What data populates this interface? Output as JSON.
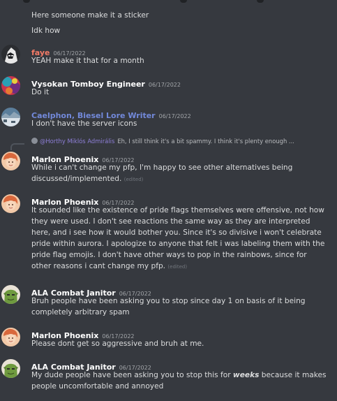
{
  "messages": [
    {
      "continuation": true,
      "lines": [
        "Here someone make it a sticker"
      ]
    },
    {
      "continuation": true,
      "lines": [
        "Idk how"
      ]
    },
    {
      "author": "faye",
      "author_color": "#f47b67",
      "timestamp": "06/17/2022",
      "avatar_icon": "anime-character-avatar",
      "lines": [
        "YEAH make it that for a month"
      ]
    },
    {
      "author": "Vysokan Tomboy Engineer",
      "author_color": "#ffffff",
      "timestamp": "06/17/2022",
      "avatar_icon": "colorful-abstract-avatar",
      "lines": [
        "Do it"
      ]
    },
    {
      "author": "Caelphon, Biesel Lore Writer",
      "author_color": "#7289da",
      "timestamp": "06/17/2022",
      "avatar_icon": "landscape-avatar",
      "lines": [
        "I don't have the server icons"
      ]
    },
    {
      "reply": {
        "author": "@Horthy Miklós Admirális",
        "text": "Eh, I still think it's a bit spammy. I think it's plenty enough ..."
      },
      "author": "Marlon Phoenix",
      "author_color": "#ffffff",
      "timestamp": "06/17/2022",
      "avatar_icon": "marlon-phoenix-avatar",
      "lines": [
        "While i can't change my pfp, I'm happy to see other alternatives being",
        "discussed/implemented."
      ],
      "edited": "(edited)"
    },
    {
      "author": "Marlon Phoenix",
      "author_color": "#ffffff",
      "timestamp": "06/17/2022",
      "avatar_icon": "marlon-phoenix-avatar",
      "lines": [
        "It sounded like the existence of pride flags themselves were offensive, not how",
        "they were used. I don't see reactions the same way as they are interpreted",
        "here, and i see how it would bother you. Since it's so divisive i won't celebrate",
        "pride within aurora. I apologize to anyone that felt i was labeling them with the",
        "pride flag emojis. I don't have other ways to pop in the rainbows, since for",
        "other reasons i cant change my pfp."
      ],
      "edited": "(edited)"
    },
    {
      "author": "ALA Combat Janitor",
      "author_color": "#ffffff",
      "timestamp": "06/17/2022",
      "avatar_icon": "green-goblin-avatar",
      "lines": [
        "Bruh people have been asking you to stop since day 1 on basis of it being",
        "completely arbitrary spam"
      ]
    },
    {
      "author": "Marlon Phoenix",
      "author_color": "#ffffff",
      "timestamp": "06/17/2022",
      "avatar_icon": "marlon-phoenix-avatar",
      "lines": [
        "Please dont get so aggressive and bruh at me."
      ]
    },
    {
      "author": "ALA Combat Janitor",
      "author_color": "#ffffff",
      "timestamp": "06/17/2022",
      "avatar_icon": "green-goblin-avatar",
      "lines_rich": [
        {
          "pre": "My dude people have been asking you to stop this for ",
          "em": "weeks",
          "post": " because it makes"
        },
        {
          "pre": "people uncomfortable and annoyed",
          "em": "",
          "post": ""
        }
      ]
    }
  ]
}
